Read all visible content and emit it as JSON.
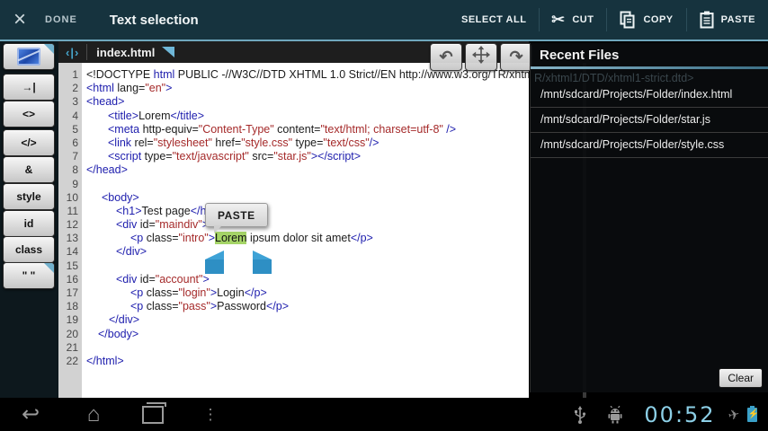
{
  "colors": {
    "action_bar_bg": "#16333e",
    "accent_line": "#6fa7bd",
    "tag_color": "#1d1dad",
    "string_color": "#a52a2a",
    "plain_color": "#1c1c1c",
    "selection_highlight": "#a5d467",
    "handle_blue": "#2e8fc4",
    "time_blue": "#8ccfe6"
  },
  "action_bar": {
    "close_icon": "×",
    "done_label": "DONE",
    "title": "Text selection",
    "select_all_label": "SELECT ALL",
    "cut_label": "CUT",
    "copy_label": "COPY",
    "paste_label": "PASTE",
    "cut_icon_glyph": "✂"
  },
  "tab_bar": {
    "file_icon_glyph": "‹|›",
    "file_name": "index.html"
  },
  "sidebar": {
    "buttons": [
      {
        "name": "insert-image",
        "kind": "icon",
        "label": "",
        "corner": true
      },
      {
        "name": "insert-tab",
        "kind": "text",
        "label": "→|",
        "corner": false
      },
      {
        "name": "insert-brackets",
        "kind": "text",
        "label": "<>",
        "corner": false
      },
      {
        "name": "insert-closing-tag",
        "kind": "text",
        "label": "</>",
        "corner": false
      },
      {
        "name": "insert-entity",
        "kind": "text",
        "label": "&",
        "corner": false
      },
      {
        "name": "insert-style",
        "kind": "text",
        "label": "style",
        "corner": false
      },
      {
        "name": "insert-id",
        "kind": "text",
        "label": "id",
        "corner": false
      },
      {
        "name": "insert-class",
        "kind": "text",
        "label": "class",
        "corner": false
      },
      {
        "name": "insert-quotes",
        "kind": "text",
        "label": "\" \"",
        "corner": true
      }
    ]
  },
  "float_tools": {
    "undo_glyph": "↶",
    "redo_glyph": "↷"
  },
  "popup": {
    "label": "PASTE"
  },
  "editor": {
    "lines": [
      {
        "n": 1,
        "ind": 0,
        "tokens": [
          [
            "p",
            "<!DOCTYPE "
          ],
          [
            "t",
            "html"
          ],
          [
            "p",
            " PUBLIC -//W3C//DTD XHTML 1.0 Strict//EN http://www.w3.org/TR/xhtml1/DTD/xhtml1-strict.dtd>"
          ]
        ]
      },
      {
        "n": 2,
        "ind": 0,
        "tokens": [
          [
            "t",
            "<html"
          ],
          [
            "p",
            " lang="
          ],
          [
            "s",
            "\"en\""
          ],
          [
            "t",
            ">"
          ]
        ]
      },
      {
        "n": 3,
        "ind": 0,
        "tokens": [
          [
            "t",
            "<head>"
          ]
        ]
      },
      {
        "n": 4,
        "ind": 24,
        "tokens": [
          [
            "t",
            "<title>"
          ],
          [
            "p",
            "Lorem"
          ],
          [
            "t",
            "</title>"
          ]
        ]
      },
      {
        "n": 5,
        "ind": 24,
        "tokens": [
          [
            "t",
            "<meta"
          ],
          [
            "p",
            " http-equiv="
          ],
          [
            "s",
            "\"Content-Type\""
          ],
          [
            "p",
            " content="
          ],
          [
            "s",
            "\"text/html; charset=utf-8\""
          ],
          [
            "t",
            " />"
          ]
        ]
      },
      {
        "n": 6,
        "ind": 24,
        "tokens": [
          [
            "t",
            "<link"
          ],
          [
            "p",
            " rel="
          ],
          [
            "s",
            "\"stylesheet\""
          ],
          [
            "p",
            " href="
          ],
          [
            "s",
            "\"style.css\""
          ],
          [
            "p",
            " type="
          ],
          [
            "s",
            "\"text/css\""
          ],
          [
            "t",
            "/>"
          ]
        ]
      },
      {
        "n": 7,
        "ind": 24,
        "tokens": [
          [
            "t",
            "<script"
          ],
          [
            "p",
            " type="
          ],
          [
            "s",
            "\"text/javascript\""
          ],
          [
            "p",
            " src="
          ],
          [
            "s",
            "\"star.js\""
          ],
          [
            "t",
            "></script>"
          ]
        ]
      },
      {
        "n": 8,
        "ind": 0,
        "tokens": [
          [
            "t",
            "</head>"
          ]
        ]
      },
      {
        "n": 9,
        "ind": 0,
        "tokens": []
      },
      {
        "n": 10,
        "ind": 17,
        "tokens": [
          [
            "t",
            "<body>"
          ]
        ]
      },
      {
        "n": 11,
        "ind": 33,
        "tokens": [
          [
            "t",
            "<h1>"
          ],
          [
            "p",
            "Test page"
          ],
          [
            "t",
            "</h1>"
          ]
        ]
      },
      {
        "n": 12,
        "ind": 33,
        "tokens": [
          [
            "t",
            "<div"
          ],
          [
            "p",
            " id="
          ],
          [
            "s",
            "\"maindiv\""
          ],
          [
            "t",
            ">"
          ]
        ]
      },
      {
        "n": 13,
        "ind": 49,
        "tokens": [
          [
            "t",
            "<p"
          ],
          [
            "p",
            " class="
          ],
          [
            "s",
            "\"intro\""
          ],
          [
            "t",
            ">"
          ],
          [
            "h",
            "Lorem"
          ],
          [
            "p",
            " ipsum dolor sit amet"
          ],
          [
            "t",
            "</p>"
          ]
        ]
      },
      {
        "n": 14,
        "ind": 33,
        "tokens": [
          [
            "t",
            "</div>"
          ]
        ]
      },
      {
        "n": 15,
        "ind": 0,
        "tokens": []
      },
      {
        "n": 16,
        "ind": 33,
        "tokens": [
          [
            "t",
            "<div"
          ],
          [
            "p",
            " id="
          ],
          [
            "s",
            "\"account\""
          ],
          [
            "t",
            ">"
          ]
        ]
      },
      {
        "n": 17,
        "ind": 49,
        "tokens": [
          [
            "t",
            "<p"
          ],
          [
            "p",
            " class="
          ],
          [
            "s",
            "\"login\""
          ],
          [
            "t",
            ">"
          ],
          [
            "p",
            "Login"
          ],
          [
            "t",
            "</p>"
          ]
        ]
      },
      {
        "n": 18,
        "ind": 49,
        "tokens": [
          [
            "t",
            "<p"
          ],
          [
            "p",
            " class="
          ],
          [
            "s",
            "\"pass\""
          ],
          [
            "t",
            ">"
          ],
          [
            "p",
            "Password"
          ],
          [
            "t",
            "</p>"
          ]
        ]
      },
      {
        "n": 19,
        "ind": 25,
        "tokens": [
          [
            "t",
            "</div>"
          ]
        ]
      },
      {
        "n": 20,
        "ind": 13,
        "tokens": [
          [
            "t",
            "</body>"
          ]
        ]
      },
      {
        "n": 21,
        "ind": 0,
        "tokens": []
      },
      {
        "n": 22,
        "ind": 0,
        "tokens": [
          [
            "t",
            "</html>"
          ]
        ]
      }
    ]
  },
  "panel": {
    "title": "Recent Files",
    "see_through_text": "R/xhtml1/DTD/xhtml1-strict.dtd>",
    "files": [
      "/mnt/sdcard/Projects/Folder/index.html",
      "/mnt/sdcard/Projects/Folder/star.js",
      "/mnt/sdcard/Projects/Folder/style.css"
    ],
    "clear_label": "Clear"
  },
  "navbar": {
    "back_glyph": "↩",
    "home_glyph": "⌂",
    "menu_glyph": "⋮",
    "plane_glyph": "✈",
    "bolt_glyph": "⚡",
    "time": "00:52"
  }
}
